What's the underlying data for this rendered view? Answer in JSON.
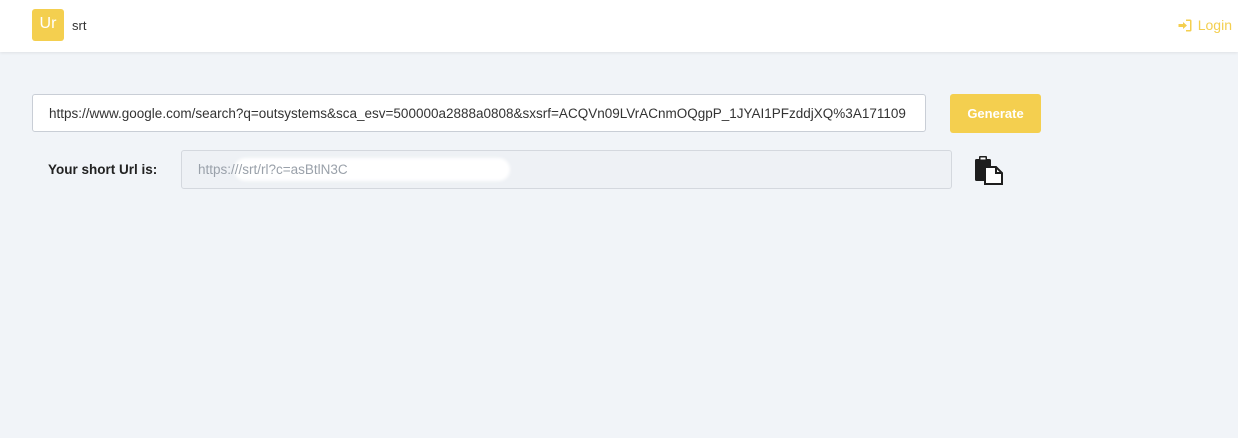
{
  "header": {
    "logo_text": "Ur",
    "app_name": "srt",
    "login_label": "Login",
    "login_icon": "sign-in-icon",
    "accent_color": "#f4cf4f"
  },
  "form": {
    "url_value": "https://www.google.com/search?q=outsystems&sca_esv=500000a2888a0808&sxsrf=ACQVn09LVrACnmOQgpP_1JYAI1PFzddjXQ%3A171109",
    "generate_label": "Generate"
  },
  "result": {
    "label": "Your short Url is:",
    "short_url_prefix": "https://",
    "short_url_suffix": "/srt/rl?c=asBtlN3C",
    "copy_icon": "clipboard-copy-icon"
  }
}
